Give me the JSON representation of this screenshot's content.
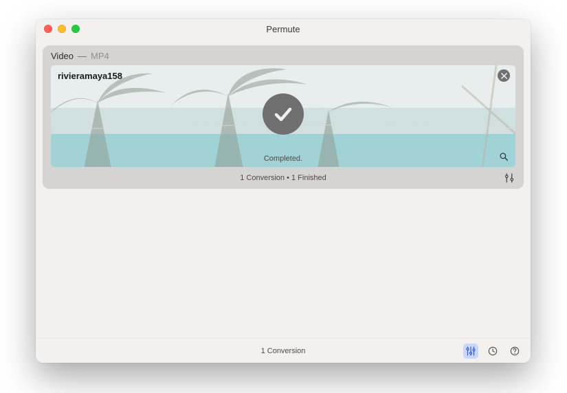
{
  "window": {
    "title": "Permute"
  },
  "card": {
    "category": "Video",
    "separator": "—",
    "format": "MP4",
    "footer": "1 Conversion • 1 Finished"
  },
  "item": {
    "filename": "rivieramaya158",
    "status": "Completed."
  },
  "bottom": {
    "summary": "1 Conversion"
  },
  "icons": {
    "close": "close-icon",
    "check": "checkmark-icon",
    "magnify": "magnifier-icon",
    "sliders": "settings-sliders-icon",
    "grid": "presets-icon",
    "history": "history-icon",
    "help": "help-icon"
  }
}
